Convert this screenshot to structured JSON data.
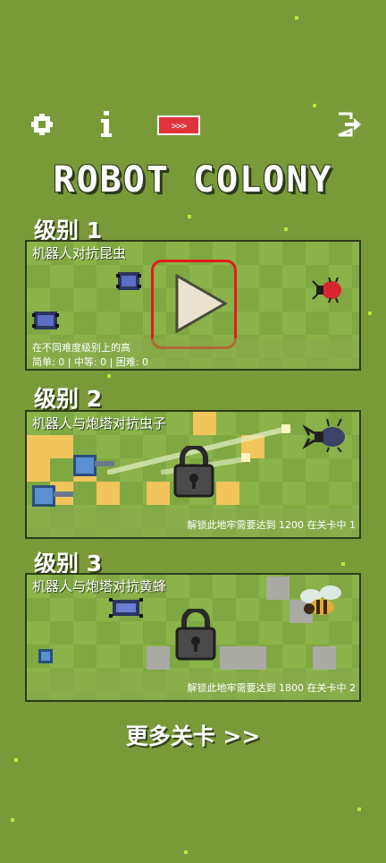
{
  "header": {
    "ff_label": ">>>",
    "info_label": "i"
  },
  "title": "ROBOT COLONY",
  "levels": [
    {
      "label": "级别 1",
      "title": "机器人对抗昆虫",
      "foot_line1": "在不同难度级别上的高",
      "foot_line2": "简单: 0 | 中等: 0 | 困难: 0"
    },
    {
      "label": "级别 2",
      "title": "机器人与炮塔对抗虫子",
      "unlock": "解锁此地牢需要达到 1200 在关卡中 1"
    },
    {
      "label": "级别 3",
      "title": "机器人与炮塔对抗黄蜂",
      "unlock": "解锁此地牢需要达到 1800 在关卡中 2"
    }
  ],
  "more_levels": "更多关卡 >>",
  "colors": {
    "background": "#7a9a3a",
    "accent_red": "#e01c1c",
    "ff_button": "#e0333a",
    "sand_tile": "#f1c45c"
  }
}
